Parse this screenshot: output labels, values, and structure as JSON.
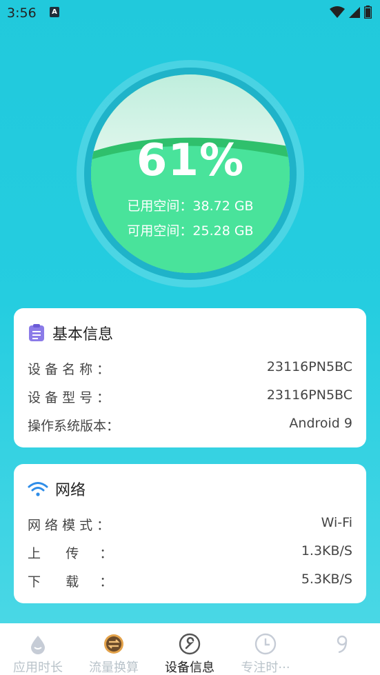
{
  "status_bar": {
    "time": "3:56",
    "notification_badge": "A"
  },
  "storage": {
    "percent": "61%",
    "used_line": "已用空间：38.72 GB",
    "free_line": "可用空间：25.28 GB",
    "used_fraction": 0.61
  },
  "basic_info": {
    "title": "基本信息",
    "rows": [
      {
        "label": "设 备 名 称 ：",
        "value": "23116PN5BC"
      },
      {
        "label": "设 备 型 号 ：",
        "value": "23116PN5BC"
      },
      {
        "label": "操作系统版本：",
        "value": "Android 9"
      }
    ]
  },
  "network": {
    "title": "网络",
    "rows": [
      {
        "label": "网 络 模 式 ：",
        "value": "Wi-Fi"
      },
      {
        "label": "上      传     ：",
        "value": "1.3KB/S"
      },
      {
        "label": "下      载     ：",
        "value": "5.3KB/S"
      }
    ]
  },
  "bottom_nav": {
    "items": [
      {
        "label": "应用时长",
        "icon": "drop-icon"
      },
      {
        "label": "流量换算",
        "icon": "swap-icon"
      },
      {
        "label": "设备信息",
        "icon": "wrench-icon",
        "active": true
      },
      {
        "label": "专注时···",
        "icon": "clock-icon"
      },
      {
        "label": "",
        "icon": "nine-icon"
      }
    ]
  },
  "colors": {
    "accent": "#25cde0",
    "gauge_green": "#47e39a",
    "ring": "#1fb3c9"
  }
}
